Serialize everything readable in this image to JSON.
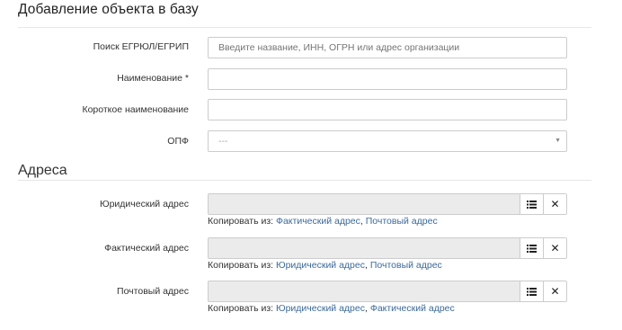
{
  "page": {
    "title": "Добавление объекта в базу"
  },
  "fields": {
    "search": {
      "label": "Поиск ЕГРЮЛ/ЕГРИП",
      "placeholder": "Введите название, ИНН, ОГРН или адрес организации",
      "value": ""
    },
    "name": {
      "label": "Наименование *",
      "value": ""
    },
    "short_name": {
      "label": "Короткое наименование",
      "value": ""
    },
    "opf": {
      "label": "ОПФ",
      "selected": "---"
    }
  },
  "addresses": {
    "section_title": "Адреса",
    "copy_prefix": "Копировать из:",
    "separator": ",",
    "legal": {
      "label": "Юридический адрес",
      "value": "",
      "copy_from": [
        "Фактический адрес",
        "Почтовый адрес"
      ]
    },
    "actual": {
      "label": "Фактический адрес",
      "value": "",
      "copy_from": [
        "Юридический адрес",
        "Почтовый адрес"
      ]
    },
    "postal": {
      "label": "Почтовый адрес",
      "value": "",
      "copy_from": [
        "Юридический адрес",
        "Фактический адрес"
      ]
    }
  },
  "icons": {
    "list": "list-icon",
    "clear": "close-icon",
    "dropdown": "caret-down-icon"
  },
  "colors": {
    "link": "#3a6a9c",
    "disabled_bg": "#ebebeb",
    "border": "#cccccc"
  }
}
